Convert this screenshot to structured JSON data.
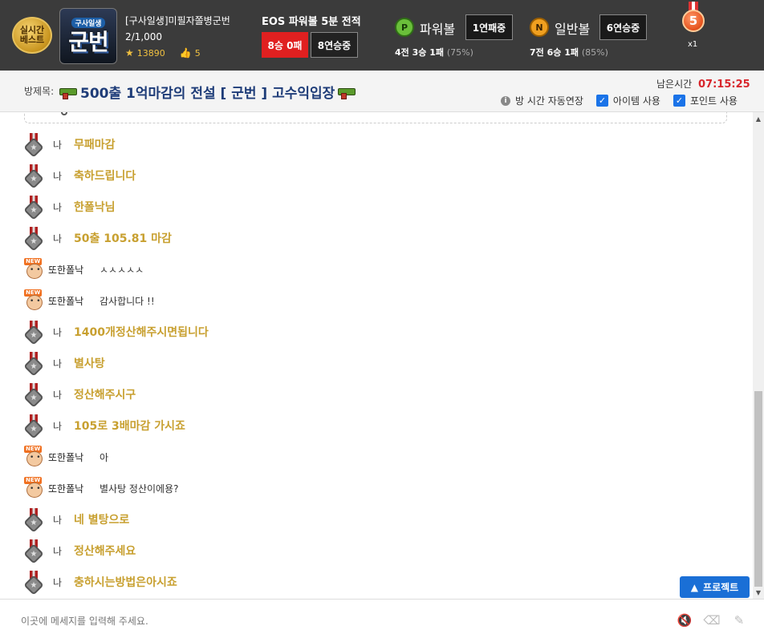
{
  "header": {
    "realtime_badge": [
      "실시간",
      "베스트"
    ],
    "profile": {
      "sub": "구사일생",
      "main": "군번"
    },
    "user_name": "[구사일생]미필자쫄병군번",
    "user_count": "2/1,000",
    "stars": "13890",
    "likes": "5",
    "record_title": "EOS 파워볼 5분 전적",
    "record_result": "8승 0패",
    "record_streak": "8연승중",
    "powerball": {
      "icon": "P",
      "label": "파워볼",
      "streak": "1연패중",
      "record": "4전 3승 1패",
      "pct": "(75%)"
    },
    "normalball": {
      "icon": "N",
      "label": "일반볼",
      "streak": "6연승중",
      "record": "7전 6승 1패",
      "pct": "(85%)"
    },
    "medal_number": "5",
    "medal_count": "x1"
  },
  "room": {
    "label": "방제목:",
    "title": "500출 1억마감의 전설 [ 군번 ] 고수익입장",
    "remain_label": "남은시간",
    "remain_time": "07:15:25",
    "options": {
      "extend": "방 시간 자동연장",
      "item": "아이템 사용",
      "point": "포인트 사용"
    }
  },
  "messages": [
    {
      "type": "me",
      "nick": "나",
      "text": "무패마감"
    },
    {
      "type": "me",
      "nick": "나",
      "text": "축하드립니다"
    },
    {
      "type": "me",
      "nick": "나",
      "text": "한폴낙님"
    },
    {
      "type": "me",
      "nick": "나",
      "text": "50출 105.81 마감"
    },
    {
      "type": "other",
      "nick": "또한폴낙",
      "text": "ㅅㅅㅅㅅㅅ"
    },
    {
      "type": "other",
      "nick": "또한폴낙",
      "text": "감사합니다 !!"
    },
    {
      "type": "me",
      "nick": "나",
      "text": "1400개정산해주시면됩니다"
    },
    {
      "type": "me",
      "nick": "나",
      "text": "별사탕"
    },
    {
      "type": "me",
      "nick": "나",
      "text": "정산해주시구"
    },
    {
      "type": "me",
      "nick": "나",
      "text": "105로 3배마감 가시죠"
    },
    {
      "type": "other",
      "nick": "또한폴낙",
      "text": "아"
    },
    {
      "type": "other",
      "nick": "또한폴낙",
      "text": "별사탕 정산이에용?"
    },
    {
      "type": "me",
      "nick": "나",
      "text": "네 별탕으로"
    },
    {
      "type": "me",
      "nick": "나",
      "text": "정산해주세요"
    },
    {
      "type": "me",
      "nick": "나",
      "text": "충하시는방법은아시죠"
    }
  ],
  "protect_button": "프로젝트",
  "input": {
    "placeholder": "이곳에 메세지를 입력해 주세요."
  },
  "colors": {
    "header_bg": "#3b3b3b",
    "room_title": "#1e3c78",
    "my_message": "#c8a030",
    "time_red": "#d8262c",
    "accent_blue": "#1a6fd6"
  }
}
